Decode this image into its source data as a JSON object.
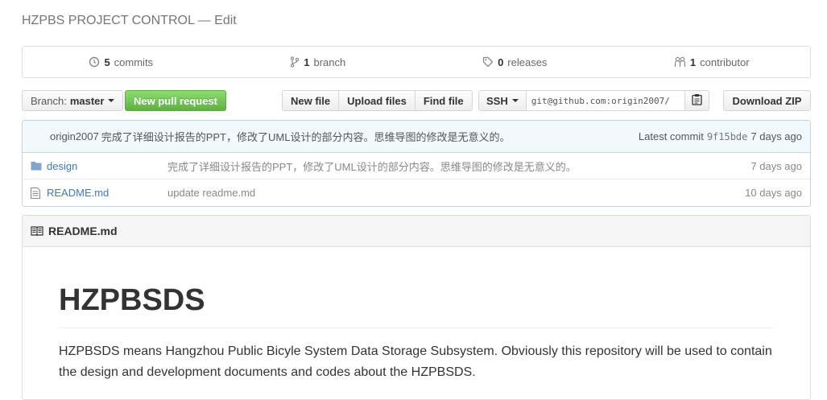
{
  "repo": {
    "description": "HZPBS PROJECT CONTROL",
    "separator": " — ",
    "edit_label": "Edit"
  },
  "summary": {
    "commits_count": "5",
    "commits_label": "commits",
    "branches_count": "1",
    "branches_label": "branch",
    "releases_count": "0",
    "releases_label": "releases",
    "contributors_count": "1",
    "contributors_label": "contributor"
  },
  "toolbar": {
    "branch_prefix": "Branch:",
    "branch_name": "master",
    "new_pr_label": "New pull request",
    "new_file_label": "New file",
    "upload_files_label": "Upload files",
    "find_file_label": "Find file",
    "clone_protocol": "SSH",
    "clone_url": "git@github.com:origin2007/",
    "download_zip_label": "Download ZIP"
  },
  "latest_commit": {
    "author": "origin2007",
    "message": "完成了详细设计报告的PPT，修改了UML设计的部分内容。思维导图的修改是无意义的。",
    "latest_label": "Latest commit",
    "sha": "9f15bde",
    "age": "7 days ago"
  },
  "files": [
    {
      "type": "folder",
      "name": "design",
      "message": "完成了详细设计报告的PPT，修改了UML设计的部分内容。思维导图的修改是无意义的。",
      "age": "7 days ago"
    },
    {
      "type": "file",
      "name": "README.md",
      "message": "update readme.md",
      "age": "10 days ago"
    }
  ],
  "readme": {
    "header": "README.md",
    "title": "HZPBSDS",
    "paragraph": "HZPBSDS means Hangzhou Public Bicyle System Data Storage Subsystem. Obviously this repository will be used to contain the design and development documents and codes about the HZPBSDS."
  },
  "colors": {
    "link": "#4078c0",
    "primary_button": "#60b044",
    "commit_bar": "#f2f9fc"
  }
}
